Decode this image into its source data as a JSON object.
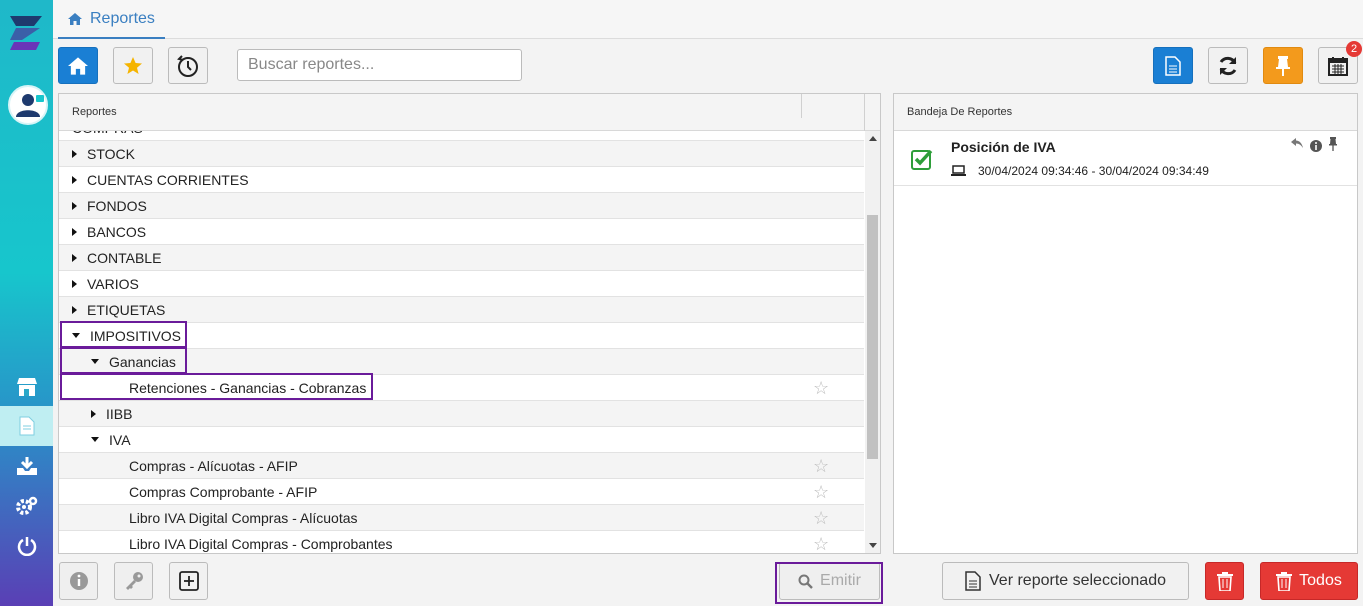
{
  "app": {
    "tab_label": "Reportes"
  },
  "toolbar": {
    "search_placeholder": "Buscar reportes...",
    "notification_count": "2"
  },
  "left_panel": {
    "header": "Reportes",
    "rows": [
      {
        "label": "COMPRAS",
        "level": 0,
        "caret": "none"
      },
      {
        "label": "STOCK",
        "level": 0,
        "caret": "right"
      },
      {
        "label": "CUENTAS CORRIENTES",
        "level": 0,
        "caret": "right"
      },
      {
        "label": "FONDOS",
        "level": 0,
        "caret": "right"
      },
      {
        "label": "BANCOS",
        "level": 0,
        "caret": "right"
      },
      {
        "label": "CONTABLE",
        "level": 0,
        "caret": "right"
      },
      {
        "label": "VARIOS",
        "level": 0,
        "caret": "right"
      },
      {
        "label": "ETIQUETAS",
        "level": 0,
        "caret": "right"
      },
      {
        "label": "IMPOSITIVOS",
        "level": 0,
        "caret": "down"
      },
      {
        "label": "Ganancias",
        "level": 1,
        "caret": "down"
      },
      {
        "label": "Retenciones - Ganancias - Cobranzas",
        "level": 2,
        "caret": "none",
        "star": true
      },
      {
        "label": "IIBB",
        "level": 1,
        "caret": "right"
      },
      {
        "label": "IVA",
        "level": 1,
        "caret": "down"
      },
      {
        "label": "Compras - Alícuotas - AFIP",
        "level": 2,
        "caret": "none",
        "star": true
      },
      {
        "label": "Compras Comprobante - AFIP",
        "level": 2,
        "caret": "none",
        "star": true
      },
      {
        "label": "Libro IVA Digital Compras - Alícuotas",
        "level": 2,
        "caret": "none",
        "star": true
      },
      {
        "label": "Libro IVA Digital Compras - Comprobantes",
        "level": 2,
        "caret": "none",
        "star": true
      }
    ]
  },
  "right_panel": {
    "header": "Bandeja De Reportes",
    "items": [
      {
        "title": "Posición de IVA",
        "date_range": "30/04/2024 09:34:46 - 30/04/2024 09:34:49"
      }
    ]
  },
  "bottom": {
    "emit_label": "Emitir",
    "view_label": "Ver reporte seleccionado",
    "all_label": "Todos"
  },
  "colors": {
    "accent": "#1a7fd4",
    "highlight": "#6a1b9a",
    "danger": "#e53935",
    "pin": "#f39a1c"
  }
}
